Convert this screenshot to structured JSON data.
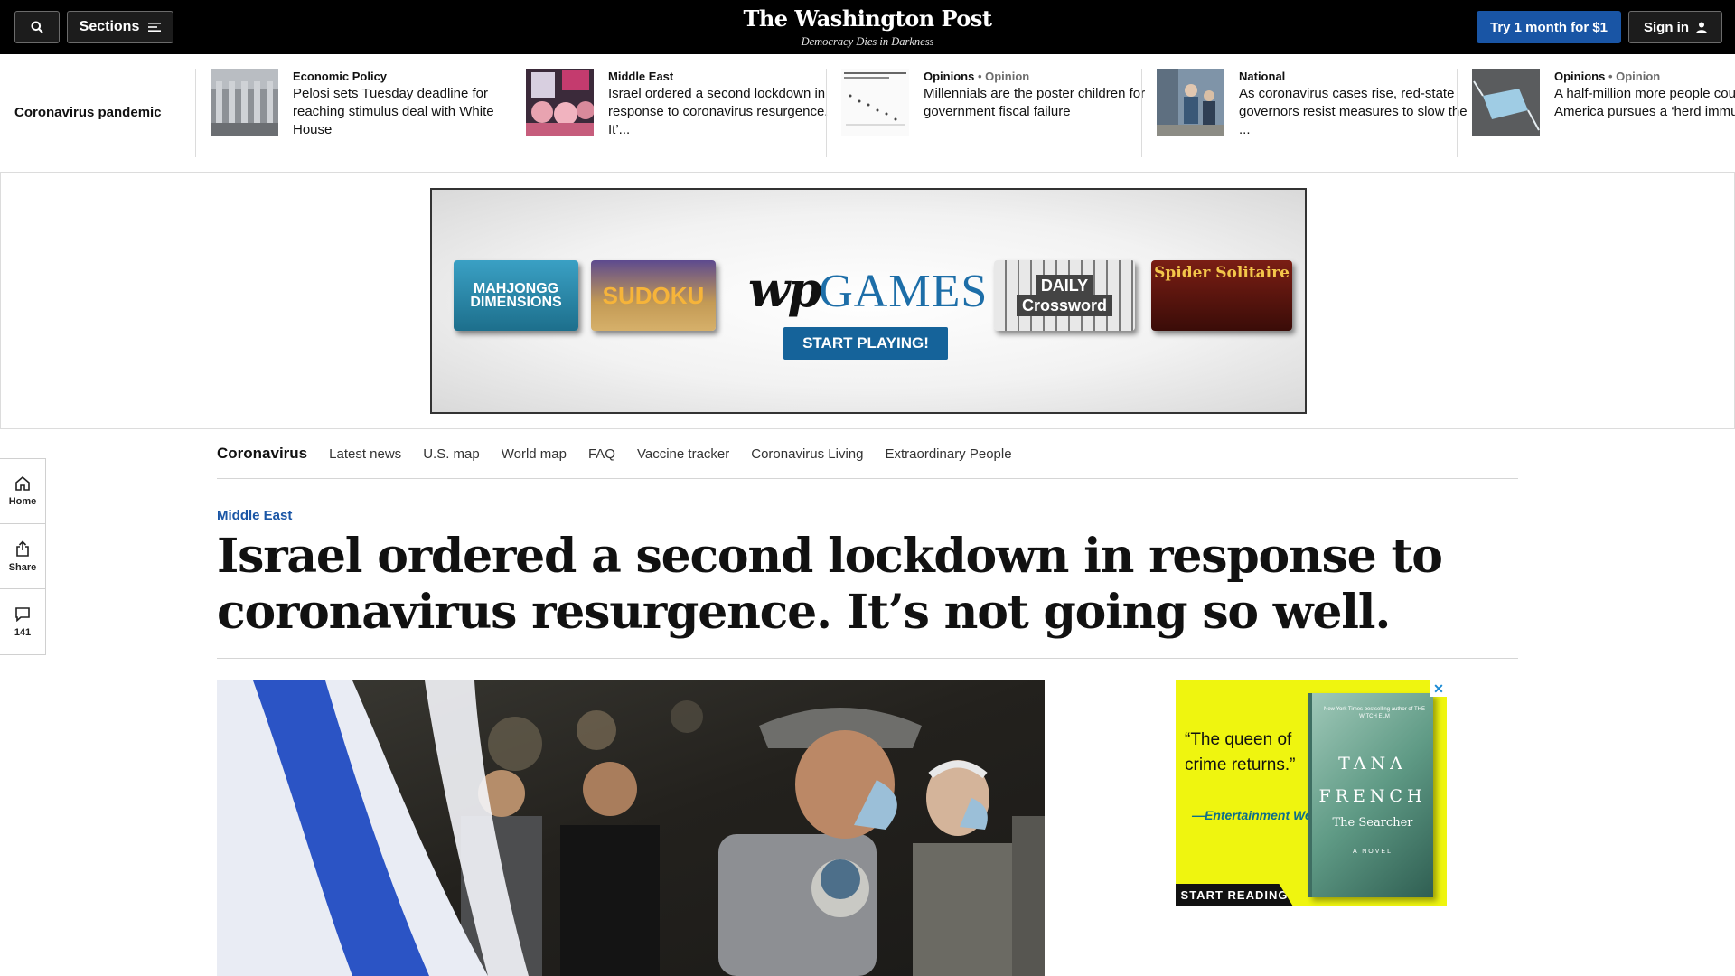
{
  "topbar": {
    "sections_label": "Sections",
    "logo": "The Washington Post",
    "tagline": "Democracy Dies in Darkness",
    "try_label": "Try 1 month for $1",
    "signin_label": "Sign in",
    "brand_blue": "#1955a5"
  },
  "strip": {
    "label": "Coronavirus pandemic",
    "stories": [
      {
        "kicker": "Economic Policy",
        "opinion": "",
        "headline": "Pelosi sets Tuesday deadline for reaching stimulus deal with White House"
      },
      {
        "kicker": "Middle East",
        "opinion": "",
        "headline": "Israel ordered a second lockdown in response to coronavirus resurgence. It’..."
      },
      {
        "kicker": "Opinions",
        "opinion": "• Opinion",
        "headline": "Millennials are the poster children for government fiscal failure"
      },
      {
        "kicker": "National",
        "opinion": "",
        "headline": "As coronavirus cases rise, red-state governors resist measures to slow the ..."
      },
      {
        "kicker": "Opinions",
        "opinion": "• Opinion",
        "headline": "A half-million more people could die if America pursues a ‘herd immunity’ p..."
      }
    ]
  },
  "ad_games": {
    "tile1": "MAHJONGG DIMENSIONS",
    "tile2": "SUDOKU",
    "logo_wp": "wp",
    "logo_games": "GAMES",
    "cta": "START PLAYING!",
    "tile3_line1": "DAILY",
    "tile3_line2": "Crossword",
    "tile4": "Spider Solitaire"
  },
  "rail": {
    "home": "Home",
    "share": "Share",
    "comments": "141"
  },
  "secnav": {
    "main": "Coronavirus",
    "links": [
      "Latest news",
      "U.S. map",
      "World map",
      "FAQ",
      "Vaccine tracker",
      "Coronavirus Living",
      "Extraordinary People"
    ]
  },
  "article": {
    "kicker": "Middle East",
    "headline": "Israel ordered a second lockdown in response to coronavirus resurgence. It’s not going so well."
  },
  "book_ad": {
    "quote": "“The queen of crime returns.”",
    "attribution": "—Entertainment Weekly",
    "blurb": "New York Times bestselling author of THE WITCH ELM",
    "author": "TANA FRENCH",
    "title": "The Searcher",
    "novel": "A NOVEL",
    "cta": "START READING",
    "close": "✕",
    "bg_color": "#eff50f"
  }
}
